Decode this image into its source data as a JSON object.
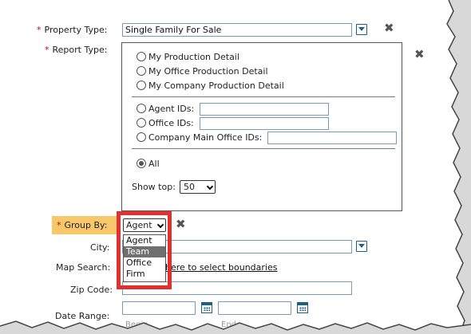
{
  "form": {
    "property_type": {
      "label": "Property Type:",
      "value": "Single Family For Sale"
    },
    "report_type": {
      "label": "Report Type:",
      "options": [
        "My Production Detail",
        "My Office Production Detail",
        "My Company Production Detail"
      ],
      "agent_ids_label": "Agent IDs:",
      "office_ids_label": "Office IDs:",
      "company_main_office_ids_label": "Company Main Office IDs:",
      "all_label": "All",
      "show_top_label": "Show top:",
      "show_top_value": "50"
    },
    "group_by": {
      "label": "Group By:",
      "selected": "Agent",
      "options": [
        "Agent",
        "Team",
        "Office",
        "Firm"
      ],
      "highlighted": "Team"
    },
    "city": {
      "label": "City:"
    },
    "map_search": {
      "label": "Map Search:",
      "link_text": "here to select boundaries"
    },
    "zip_code": {
      "label": "Zip Code:"
    },
    "date_range": {
      "label": "Date Range:",
      "begin_hint": "Begin",
      "end_hint": "End"
    },
    "required_marker": "*"
  },
  "icons": {
    "dropdown": "chevron-down-square-icon",
    "remove": "close-icon",
    "calendar": "calendar-icon"
  },
  "colors": {
    "required": "#d20000",
    "highlight": "#f7c76a",
    "annotation_frame": "#e03030",
    "accent": "#1d5f85"
  }
}
